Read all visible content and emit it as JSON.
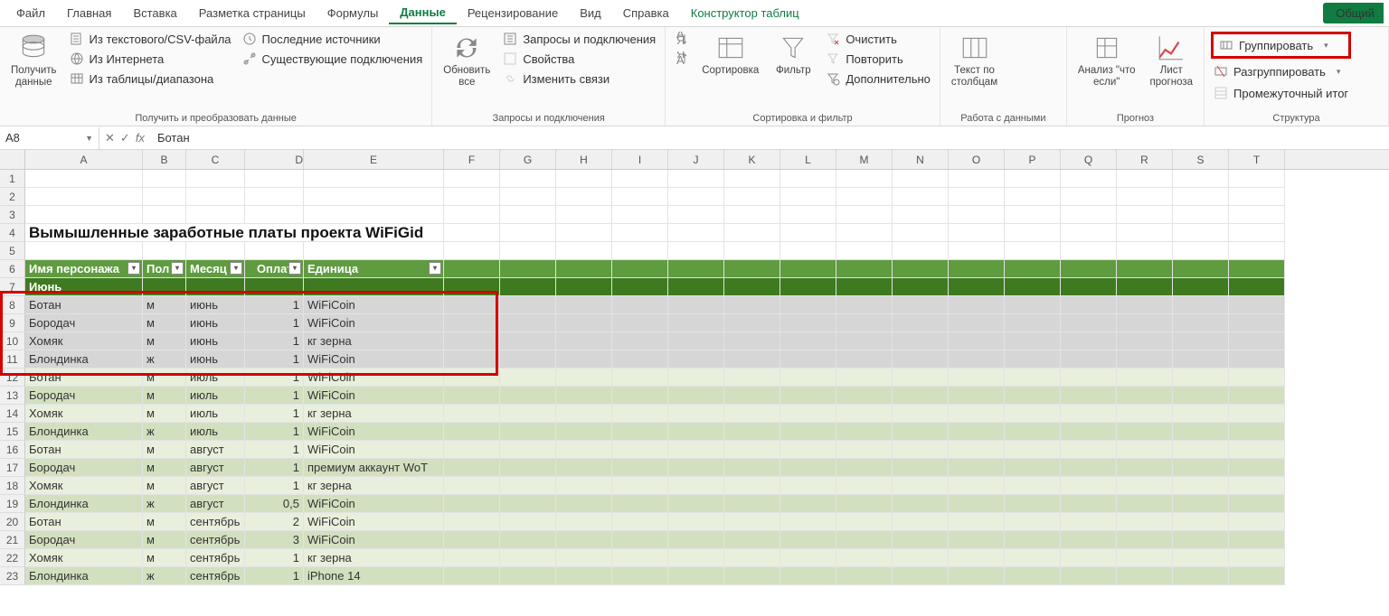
{
  "menu": {
    "file": "Файл",
    "home": "Главная",
    "insert": "Вставка",
    "layout": "Разметка страницы",
    "formulas": "Формулы",
    "data": "Данные",
    "review": "Рецензирование",
    "view": "Вид",
    "help": "Справка",
    "table": "Конструктор таблиц",
    "share": "Общий"
  },
  "ribbon": {
    "g1": {
      "label": "Получить и преобразовать данные",
      "getdata": "Получить\nданные",
      "csv": "Из текстового/CSV-файла",
      "web": "Из Интернета",
      "range": "Из таблицы/диапазона",
      "recent": "Последние источники",
      "existing": "Существующие подключения"
    },
    "g2": {
      "label": "Запросы и подключения",
      "refresh": "Обновить\nвсе",
      "queries": "Запросы и подключения",
      "props": "Свойства",
      "links": "Изменить связи"
    },
    "g3": {
      "label": "Сортировка и фильтр",
      "sort": "Сортировка",
      "filter": "Фильтр",
      "clear": "Очистить",
      "reapply": "Повторить",
      "adv": "Дополнительно"
    },
    "g4": {
      "label": "Работа с данными",
      "ttc": "Текст по\nстолбцам"
    },
    "g5": {
      "label": "Прогноз",
      "whatif": "Анализ \"что\nесли\"",
      "forecast": "Лист\nпрогноза"
    },
    "g6": {
      "label": "Структура",
      "group": "Группировать",
      "ungroup": "Разгруппировать",
      "subtotal": "Промежуточный итог"
    }
  },
  "fbar": {
    "name": "A8",
    "val": "Ботан"
  },
  "cols": [
    "A",
    "B",
    "C",
    "D",
    "E",
    "F",
    "G",
    "H",
    "I",
    "J",
    "K",
    "L",
    "M",
    "N",
    "O",
    "P",
    "Q",
    "R",
    "S",
    "T"
  ],
  "title": "Вымышленные заработные платы проекта WiFiGid",
  "headers": [
    "Имя персонажа",
    "Пол",
    "Месяц",
    "Оплата",
    "Единица"
  ],
  "groupRow": "Июнь",
  "data": [
    {
      "r": 8,
      "n": "Ботан",
      "g": "м",
      "m": "июнь",
      "p": "1",
      "u": "WiFiCoin",
      "sel": true,
      "b": 0
    },
    {
      "r": 9,
      "n": "Бородач",
      "g": "м",
      "m": "июнь",
      "p": "1",
      "u": "WiFiCoin",
      "sel": true,
      "b": 1
    },
    {
      "r": 10,
      "n": "Хомяк",
      "g": "м",
      "m": "июнь",
      "p": "1",
      "u": "кг зерна",
      "sel": true,
      "b": 0
    },
    {
      "r": 11,
      "n": "Блондинка",
      "g": "ж",
      "m": "июнь",
      "p": "1",
      "u": "WiFiCoin",
      "sel": true,
      "b": 1
    },
    {
      "r": 12,
      "n": "Ботан",
      "g": "м",
      "m": "июль",
      "p": "1",
      "u": "WiFiCoin",
      "b": 0
    },
    {
      "r": 13,
      "n": "Бородач",
      "g": "м",
      "m": "июль",
      "p": "1",
      "u": "WiFiCoin",
      "b": 1
    },
    {
      "r": 14,
      "n": "Хомяк",
      "g": "м",
      "m": "июль",
      "p": "1",
      "u": "кг зерна",
      "b": 0
    },
    {
      "r": 15,
      "n": "Блондинка",
      "g": "ж",
      "m": "июль",
      "p": "1",
      "u": "WiFiCoin",
      "b": 1
    },
    {
      "r": 16,
      "n": "Ботан",
      "g": "м",
      "m": "август",
      "p": "1",
      "u": "WiFiCoin",
      "b": 0
    },
    {
      "r": 17,
      "n": "Бородач",
      "g": "м",
      "m": "август",
      "p": "1",
      "u": "премиум аккаунт WoT",
      "b": 1
    },
    {
      "r": 18,
      "n": "Хомяк",
      "g": "м",
      "m": "август",
      "p": "1",
      "u": "кг зерна",
      "b": 0
    },
    {
      "r": 19,
      "n": "Блондинка",
      "g": "ж",
      "m": "август",
      "p": "0,5",
      "u": "WiFiCoin",
      "b": 1
    },
    {
      "r": 20,
      "n": "Ботан",
      "g": "м",
      "m": "сентябрь",
      "p": "2",
      "u": "WiFiCoin",
      "b": 0
    },
    {
      "r": 21,
      "n": "Бородач",
      "g": "м",
      "m": "сентябрь",
      "p": "3",
      "u": "WiFiCoin",
      "b": 1
    },
    {
      "r": 22,
      "n": "Хомяк",
      "g": "м",
      "m": "сентябрь",
      "p": "1",
      "u": "кг зерна",
      "b": 0
    },
    {
      "r": 23,
      "n": "Блондинка",
      "g": "ж",
      "m": "сентябрь",
      "p": "1",
      "u": "iPhone 14",
      "b": 1
    }
  ]
}
